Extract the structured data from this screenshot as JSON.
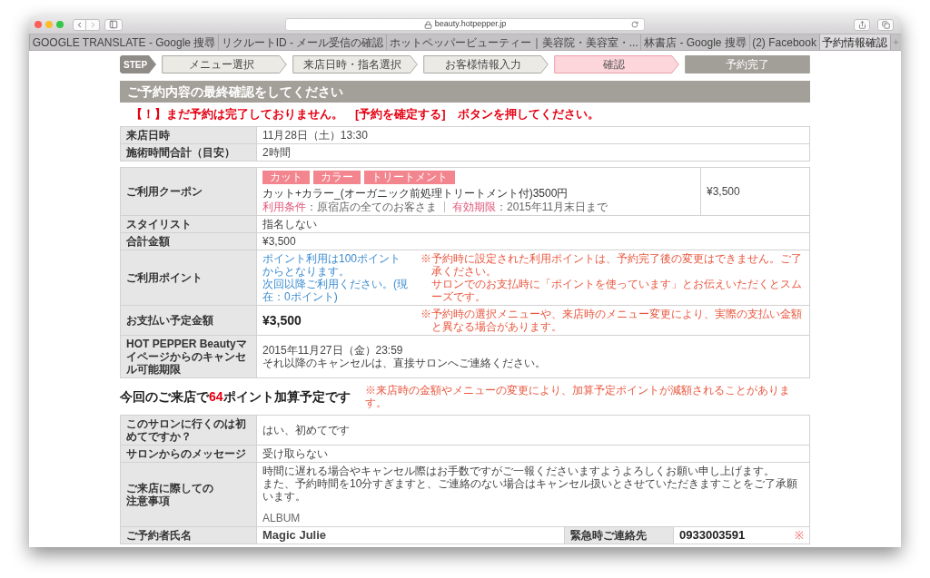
{
  "window": {
    "address": "beauty.hotpepper.jp"
  },
  "tabs": [
    {
      "label": "GOOGLE TRANSLATE - Google 搜尋",
      "selected": false
    },
    {
      "label": "リクルートID - メール受信の確認",
      "selected": false
    },
    {
      "label": "ホットペッパービューティー｜美容院・美容室・...",
      "selected": false
    },
    {
      "label": "林書店 - Google 搜尋",
      "selected": false
    },
    {
      "label": "(2) Facebook",
      "selected": false
    },
    {
      "label": "予約情報確認",
      "selected": true
    }
  ],
  "steps": {
    "badge": "STEP",
    "items": [
      {
        "label": "メニュー選択",
        "completed": true,
        "selected": false
      },
      {
        "label": "来店日時・指名選択",
        "completed": true,
        "selected": false
      },
      {
        "label": "お客様情報入力",
        "completed": true,
        "selected": false
      },
      {
        "label": "確認",
        "completed": false,
        "selected": true
      },
      {
        "label": "予約完了",
        "completed": false,
        "selected": false
      }
    ]
  },
  "heading": "ご予約内容の最終確認をしてください",
  "warning": "【！】まだ予約は完了しておりません。　[予約を確定する]　ボタンを押してください。",
  "schedule_table": {
    "rows": [
      {
        "kind": "text",
        "label": "来店日時",
        "lines": [
          "11月28日（土）13:30"
        ]
      },
      {
        "kind": "text",
        "label": "施術時間合計（目安）",
        "lines": [
          "2時間"
        ]
      }
    ]
  },
  "details_table": {
    "rows": [
      {
        "kind": "coupon",
        "label": "ご利用クーポン",
        "tags": [
          "カット",
          "カラー",
          "トリートメント"
        ],
        "title": "カット+カラー_(オーガニック前処理トリートメント付)3500円",
        "conditions": [
          {
            "label": "利用条件",
            "value": "：原宿店の全てのお客さま"
          },
          {
            "label": "有効期限",
            "value": "：2015年11月末日まで"
          }
        ],
        "price": "¥3,500"
      },
      {
        "kind": "text",
        "label": "スタイリスト",
        "lines": [
          "指名しない"
        ]
      },
      {
        "kind": "text",
        "label": "合計金額",
        "lines": [
          "¥3,500"
        ]
      },
      {
        "kind": "points",
        "label": "ご利用ポイント",
        "info": [
          "ポイント利用は100ポイントからとなります。",
          "次回以降ご利用ください。(現在：0ポイント)"
        ],
        "note": [
          "※予約時に設定された利用ポイントは、予約完了後の変更はできません。ご了承ください。",
          "サロンでのお支払時に「ポイントを使っています」とお伝えいただくとスムーズです。"
        ]
      },
      {
        "kind": "payment",
        "label": "お支払い予定金額",
        "amount": "¥3,500",
        "note": [
          "※予約時の選択メニューや、来店時のメニュー変更により、実際の支払い金額と異なる場合があります。"
        ]
      },
      {
        "kind": "text",
        "label": "HOT PEPPER Beautyマイページからのキャンセル可能期限",
        "lines": [
          "2015年11月27日（金）23:59",
          "それ以降のキャンセルは、直接サロンへご連絡ください。"
        ]
      }
    ]
  },
  "points_summary": {
    "prefix": "今回のご来店で",
    "points": "64",
    "suffix": "ポイント加算予定です",
    "note": "※来店時の金額やメニューの変更により、加算予定ポイントが減額されることがあります。"
  },
  "customer_table": {
    "rows": [
      {
        "kind": "text",
        "label": "このサロンに行くのは初めてですか？",
        "lines": [
          "はい、初めてです"
        ]
      },
      {
        "kind": "text",
        "label": "サロンからのメッセージ",
        "lines": [
          "受け取らない"
        ]
      },
      {
        "kind": "notes",
        "label_lines": [
          "ご来店に際しての",
          "注意事項"
        ],
        "lines": [
          "時間に遅れる場合やキャンセル際はお手数ですがご一報くださいますようよろしくお願い申し上げます。",
          "また、予約時間を10分すぎますと、ご連絡のない場合はキャンセル扱いとさせていただきますことをご了承願います。"
        ],
        "signature": "ALBUM"
      },
      {
        "kind": "contact",
        "label": "ご予約者氏名",
        "value": "Magic Julie",
        "contact_label": "緊急時ご連絡先",
        "contact_value": "0933003591",
        "required_mark": "※"
      }
    ]
  }
}
